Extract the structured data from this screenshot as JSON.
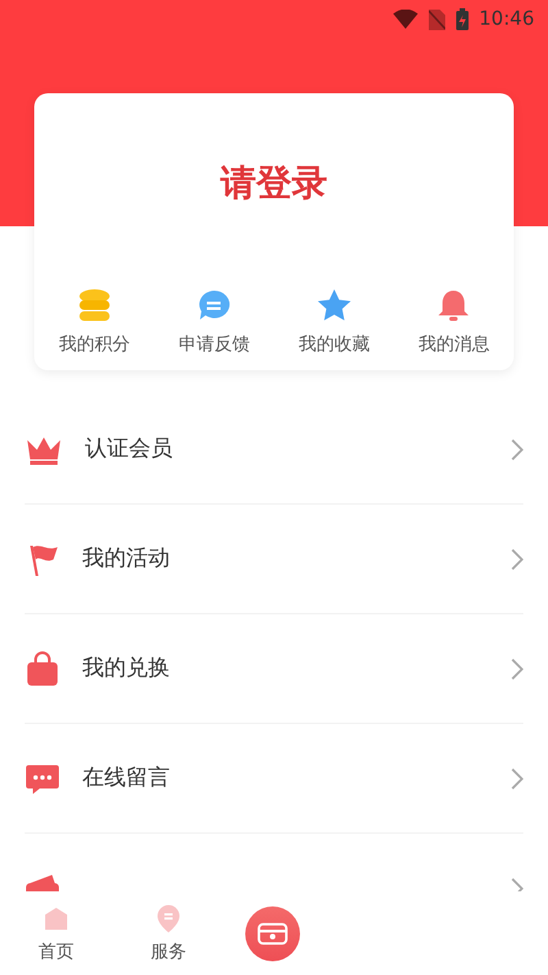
{
  "status_bar": {
    "time": "10:46"
  },
  "login_card": {
    "title": "请登录",
    "shortcuts": [
      {
        "kind": "coins",
        "label": "我的积分"
      },
      {
        "kind": "chat",
        "label": "申请反馈"
      },
      {
        "kind": "star",
        "label": "我的收藏"
      },
      {
        "kind": "bell",
        "label": "我的消息"
      }
    ]
  },
  "menu": [
    {
      "kind": "crown",
      "label": "认证会员"
    },
    {
      "kind": "flag",
      "label": "我的活动"
    },
    {
      "kind": "bag",
      "label": "我的兑换"
    },
    {
      "kind": "message",
      "label": "在线留言"
    },
    {
      "kind": "wallet"
    }
  ],
  "bottom_nav": [
    {
      "kind": "home",
      "label": "首页"
    },
    {
      "kind": "service",
      "label": "服务"
    },
    {
      "kind": "center"
    }
  ]
}
